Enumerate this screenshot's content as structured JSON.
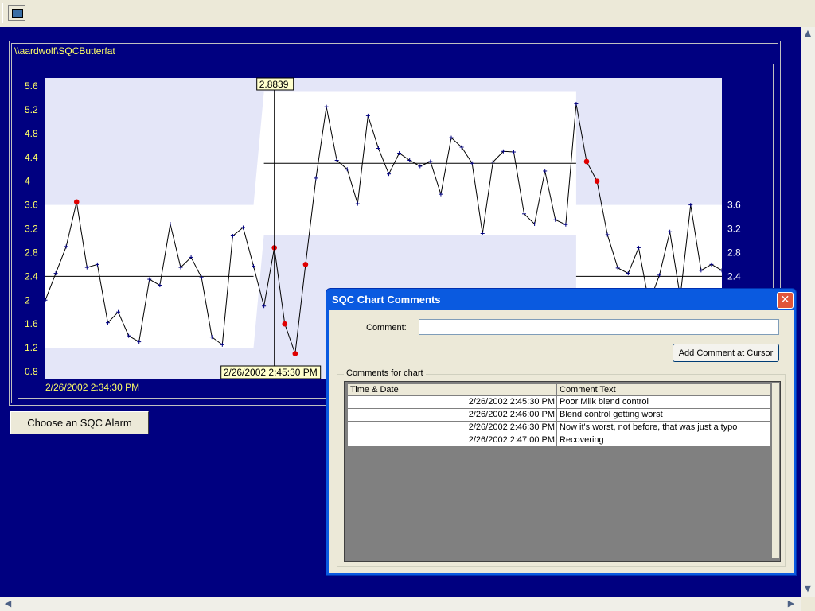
{
  "chart": {
    "path": "\\\\aardwolf\\SQCButterfat",
    "y_ticks_left": [
      "5.6",
      "5.2",
      "4.8",
      "4.4",
      "4",
      "3.6",
      "3.2",
      "2.8",
      "2.4",
      "2",
      "1.6",
      "1.2",
      "0.8"
    ],
    "y_ticks_right": [
      "3.6",
      "3.2",
      "2.8",
      "2.4"
    ],
    "start_time": "2/26/2002 2:34:30 PM",
    "cursor_value": "2.8839",
    "cursor_time": "2/26/2002 2:45:30 PM",
    "colors": {
      "background": "#000080",
      "plot_area": "#e4e6f8",
      "control_band": "#ffffff",
      "line": "#000000",
      "points": "#000080",
      "alarm_points": "#e00000",
      "labels": "#ffff66"
    }
  },
  "sqc_button": {
    "label": "Choose an SQC Alarm"
  },
  "dialog": {
    "title": "SQC Chart Comments",
    "comment_label": "Comment:",
    "comment_value": "",
    "add_button": "Add Comment at Cursor",
    "group_label": "Comments for chart",
    "columns": {
      "time": "Time & Date",
      "text": "Comment Text"
    },
    "rows": [
      {
        "time": "2/26/2002 2:45:30 PM",
        "text": "Poor Milk blend control"
      },
      {
        "time": "2/26/2002 2:46:00 PM",
        "text": "Blend control getting worst"
      },
      {
        "time": "2/26/2002 2:46:30 PM",
        "text": "Now it's worst, not before, that was just a typo"
      },
      {
        "time": "2/26/2002 2:47:00 PM",
        "text": "Recovering"
      }
    ]
  },
  "chart_data": {
    "type": "line",
    "title": "",
    "x": [
      1,
      2,
      3,
      4,
      5,
      6,
      7,
      8,
      9,
      10,
      11,
      12,
      13,
      14,
      15,
      16,
      17,
      18,
      19,
      20,
      21,
      22,
      23,
      24,
      25,
      26,
      27,
      28,
      29,
      30,
      31,
      32,
      33,
      34,
      35,
      36,
      37,
      38,
      39,
      40,
      41,
      42,
      43,
      44,
      45,
      46,
      47,
      48,
      49,
      50,
      51,
      52,
      53,
      54,
      55,
      56,
      57,
      58,
      59,
      60,
      61,
      62,
      63,
      64,
      65,
      66
    ],
    "y": [
      2.0,
      2.45,
      2.9,
      3.65,
      2.55,
      2.6,
      1.62,
      1.8,
      1.4,
      1.3,
      2.35,
      2.25,
      3.28,
      2.55,
      2.72,
      2.38,
      1.38,
      1.25,
      3.08,
      3.22,
      2.57,
      1.9,
      2.88,
      1.6,
      1.1,
      2.6,
      4.05,
      5.25,
      4.35,
      4.2,
      3.62,
      5.1,
      4.55,
      4.12,
      4.47,
      4.35,
      4.25,
      4.33,
      3.78,
      4.73,
      4.57,
      4.3,
      3.12,
      4.32,
      4.5,
      4.49,
      3.45,
      3.28,
      4.17,
      3.35,
      3.27,
      5.3,
      4.33,
      4.0,
      3.1,
      2.54,
      2.45,
      2.88,
      1.95,
      2.42,
      3.15,
      2.05,
      3.6,
      2.5,
      2.6,
      2.5
    ],
    "alarm_points": [
      {
        "x": 4,
        "y": 3.65
      },
      {
        "x": 23,
        "y": 2.88
      },
      {
        "x": 24,
        "y": 1.6
      },
      {
        "x": 25,
        "y": 1.1
      },
      {
        "x": 26,
        "y": 2.6
      },
      {
        "x": 53,
        "y": 4.33
      },
      {
        "x": 54,
        "y": 4.0
      }
    ],
    "center_lines": [
      {
        "from_x": 1,
        "to_x": 21,
        "value": 2.4
      },
      {
        "from_x": 22,
        "to_x": 52,
        "value": 4.3
      },
      {
        "from_x": 52,
        "to_x": 66,
        "value": 2.4
      }
    ],
    "control_bands": [
      {
        "from_x": 1,
        "to_x": 21,
        "lower": 1.2,
        "upper": 3.6
      },
      {
        "from_x": 22,
        "to_x": 52,
        "lower": 3.1,
        "upper": 5.5
      },
      {
        "from_x": 52,
        "to_x": 66,
        "lower": 1.2,
        "upper": 3.6
      }
    ],
    "ylim": [
      0.6,
      5.8
    ],
    "cursor_x": 23,
    "xlabel": "",
    "ylabel": ""
  }
}
